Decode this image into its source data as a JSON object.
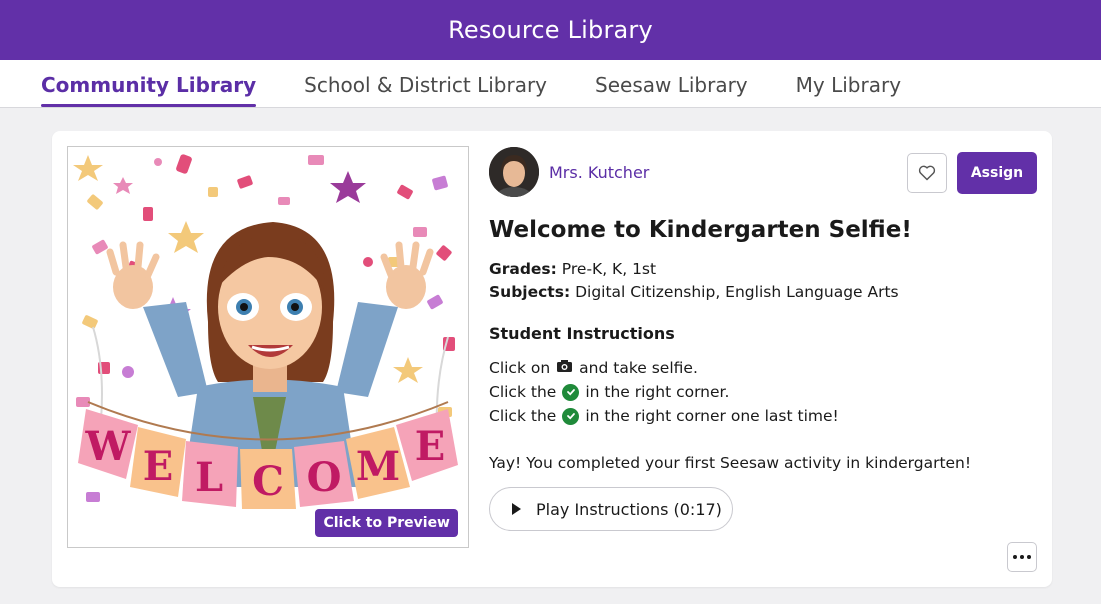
{
  "header": {
    "title": "Resource Library"
  },
  "tabs": [
    {
      "label": "Community Library",
      "active": true
    },
    {
      "label": "School & District Library",
      "active": false
    },
    {
      "label": "Seesaw Library",
      "active": false
    },
    {
      "label": "My Library",
      "active": false
    }
  ],
  "activity": {
    "preview_label": "Click to Preview",
    "preview_image_text": "WELCOME",
    "author": "Mrs. Kutcher",
    "assign_label": "Assign",
    "title": "Welcome to Kindergarten Selfie!",
    "grades_label": "Grades:",
    "grades": "Pre-K, K, 1st",
    "subjects_label": "Subjects:",
    "subjects": "Digital Citizenship, English Language Arts",
    "instructions_heading": "Student Instructions",
    "instructions": [
      {
        "before": "Click on",
        "icon": "camera-icon",
        "after": "and take selfie."
      },
      {
        "before": "Click the",
        "icon": "green-check-icon",
        "after": "in the right corner."
      },
      {
        "before": "Click the",
        "icon": "green-check-icon",
        "after": "in the right corner one last time!"
      }
    ],
    "closing": "Yay! You completed your first Seesaw activity in kindergarten!",
    "play_label": "Play Instructions (0:17)"
  },
  "colors": {
    "brand": "#6230a8",
    "check": "#1f8a3a"
  }
}
